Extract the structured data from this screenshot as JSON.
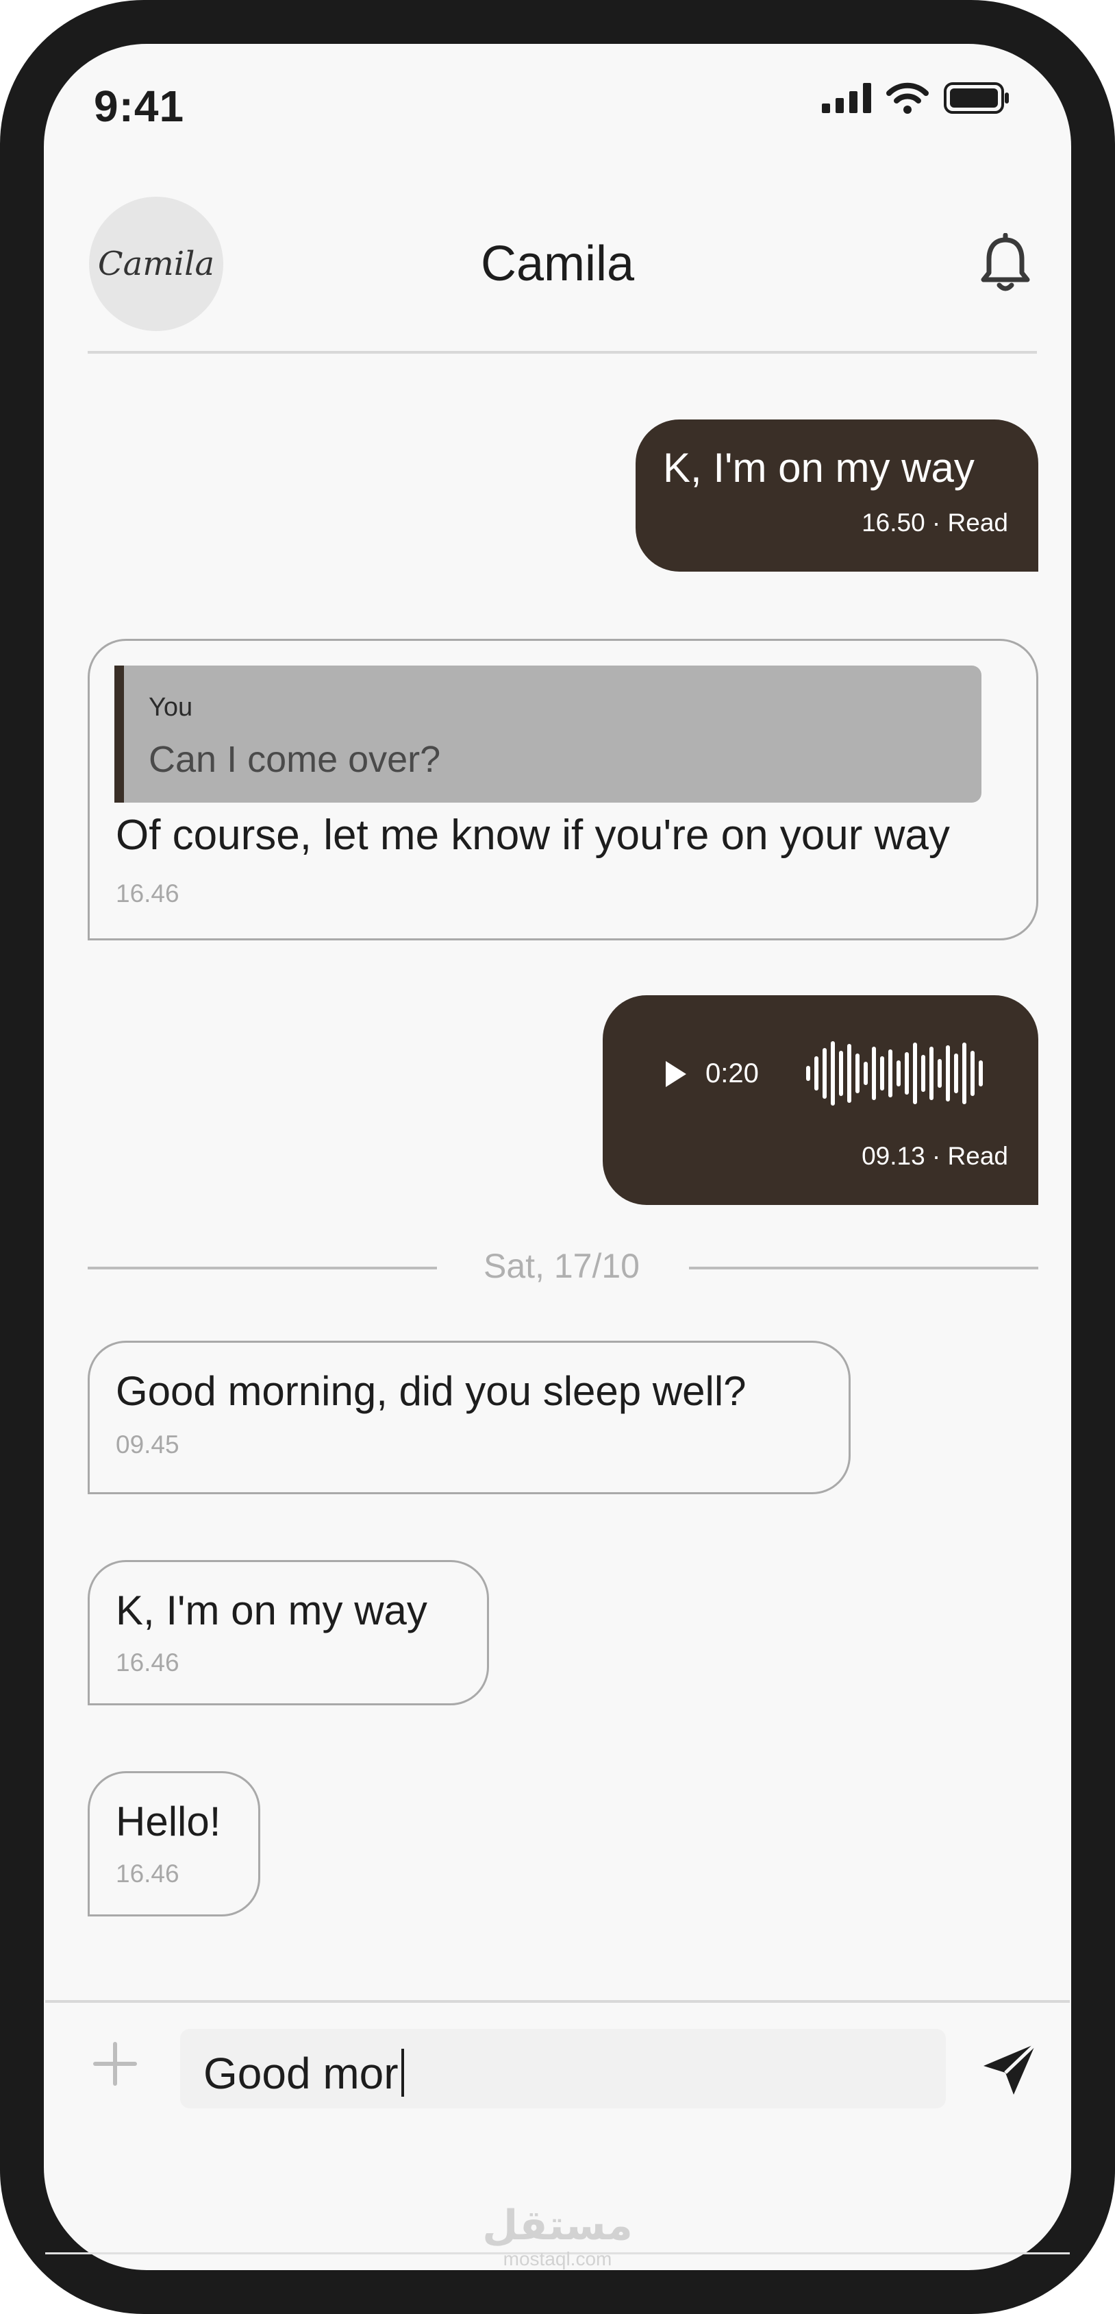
{
  "status_bar": {
    "time": "9:41"
  },
  "header": {
    "avatar_text": "Camila",
    "contact_name": "Camila"
  },
  "messages": [
    {
      "type": "outgoing",
      "text": "K, I'm on my way",
      "meta": "16.50 · Read"
    },
    {
      "type": "incoming-reply",
      "reply_to_sender": "You",
      "reply_to_text": "Can I come over?",
      "text": "Of course, let me know if you're on your way",
      "meta": "16.46"
    },
    {
      "type": "outgoing-voice",
      "duration": "0:20",
      "meta": "09.13 · Read"
    },
    {
      "type": "incoming",
      "text": "Good morning, did you sleep well?",
      "meta": "09.45"
    },
    {
      "type": "incoming",
      "text": "K, I'm on my way",
      "meta": "16.46"
    },
    {
      "type": "incoming",
      "text": "Hello!",
      "meta": "16.46"
    }
  ],
  "date_separator": "Sat, 17/10",
  "composer": {
    "value": "Good mor"
  },
  "watermark": {
    "text": "مستقل",
    "sub": "mostaql.com"
  },
  "colors": {
    "outgoing_bubble": "#3a2f27",
    "incoming_border": "#a9a9a9",
    "reply_box": "#b1b1b1",
    "screen_bg": "#f8f8f8"
  },
  "icons": [
    "cellular-signal-icon",
    "wifi-icon",
    "battery-icon",
    "bell-icon",
    "play-icon",
    "waveform-icon",
    "plus-icon",
    "send-icon"
  ]
}
